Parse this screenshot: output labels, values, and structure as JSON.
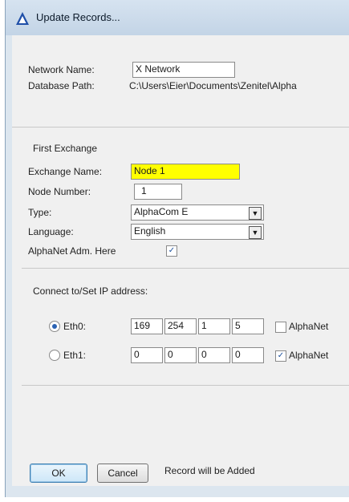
{
  "window": {
    "title": "Update Records...",
    "icon": "triangle-app-icon"
  },
  "network": {
    "name_label": "Network Name:",
    "name_value": "X Network",
    "db_path_label": "Database Path:",
    "db_path_value": "C:\\Users\\Eier\\Documents\\Zenitel\\Alpha"
  },
  "exchange": {
    "section_title": "First Exchange",
    "name_label": "Exchange Name:",
    "name_value": "Node 1",
    "node_number_label": "Node Number:",
    "node_number_value": "1",
    "type_label": "Type:",
    "type_value": "AlphaCom E",
    "language_label": "Language:",
    "language_value": "English",
    "alphanet_adm_label": "AlphaNet  Adm. Here",
    "alphanet_adm_checked": true
  },
  "ip": {
    "section_title": "Connect to/Set IP address:",
    "eth0": {
      "label": "Eth0:",
      "selected": true,
      "octets": [
        "169",
        "254",
        "1",
        "5"
      ],
      "alphanet_label": "AlphaNet",
      "alphanet_checked": false
    },
    "eth1": {
      "label": "Eth1:",
      "selected": false,
      "octets": [
        "0",
        "0",
        "0",
        "0"
      ],
      "alphanet_label": "AlphaNet",
      "alphanet_checked": true
    }
  },
  "footer": {
    "ok_label": "OK",
    "cancel_label": "Cancel",
    "status_text": "Record will be Added"
  }
}
